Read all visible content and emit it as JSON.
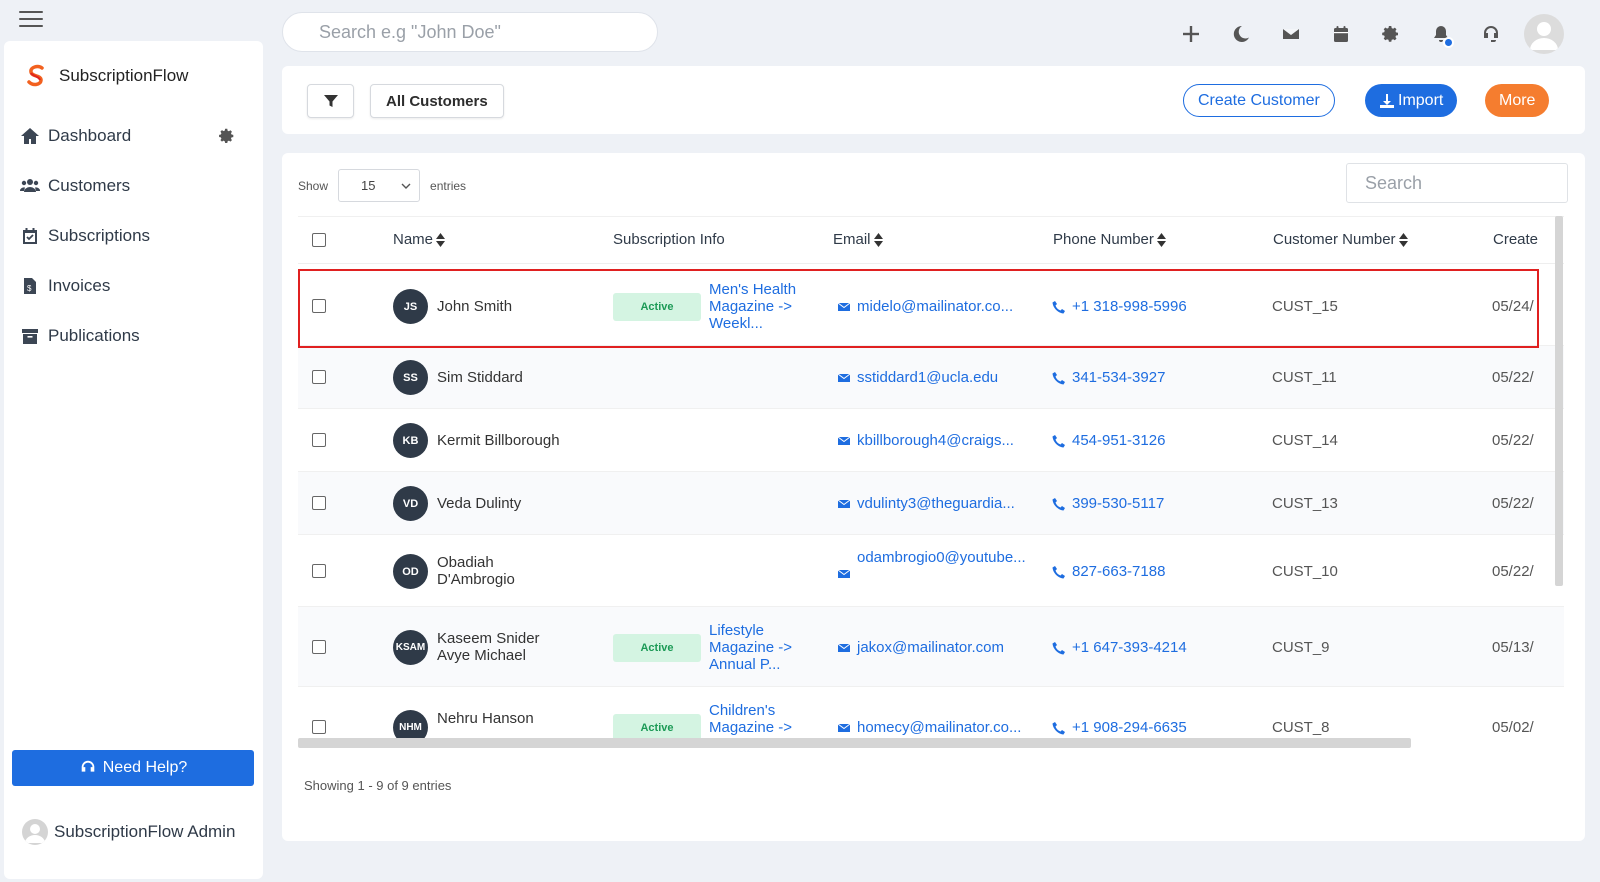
{
  "header": {
    "search_placeholder": "Search e.g \"John Doe\""
  },
  "sidebar": {
    "brand": "SubscriptionFlow",
    "items": [
      {
        "label": "Dashboard"
      },
      {
        "label": "Customers"
      },
      {
        "label": "Subscriptions"
      },
      {
        "label": "Invoices"
      },
      {
        "label": "Publications"
      }
    ],
    "help_label": "Need Help?",
    "admin_name": "SubscriptionFlow Admin"
  },
  "toolbar": {
    "view_label": "All Customers",
    "create_label": "Create Customer",
    "import_label": "Import",
    "more_label": "More"
  },
  "table": {
    "show_label": "Show",
    "entries_value": "15",
    "entries_label": "entries",
    "search_placeholder": "Search",
    "columns": {
      "name": "Name",
      "subscription": "Subscription Info",
      "email": "Email",
      "phone": "Phone Number",
      "customer_number": "Customer Number",
      "created": "Create"
    },
    "rows": [
      {
        "initials": "JS",
        "name": "John Smith",
        "status": "Active",
        "subscription": "Men's Health Magazine -> Weekl...",
        "email": "midelo@mailinator.co...",
        "phone": "+1 318-998-5996",
        "customer_number": "CUST_15",
        "created": "05/24/"
      },
      {
        "initials": "SS",
        "name": "Sim Stiddard",
        "status": "",
        "subscription": "",
        "email": "sstiddard1@ucla.edu",
        "phone": "341-534-3927",
        "customer_number": "CUST_11",
        "created": "05/22/"
      },
      {
        "initials": "KB",
        "name": "Kermit Billborough",
        "status": "",
        "subscription": "",
        "email": "kbillborough4@craigs...",
        "phone": "454-951-3126",
        "customer_number": "CUST_14",
        "created": "05/22/"
      },
      {
        "initials": "VD",
        "name": "Veda Dulinty",
        "status": "",
        "subscription": "",
        "email": "vdulinty3@theguardia...",
        "phone": "399-530-5117",
        "customer_number": "CUST_13",
        "created": "05/22/"
      },
      {
        "initials": "OD",
        "name": "Obadiah D'Ambrogio",
        "status": "",
        "subscription": "",
        "email": "odambrogio0@youtube...",
        "phone": "827-663-7188",
        "customer_number": "CUST_10",
        "created": "05/22/"
      },
      {
        "initials": "KSAM",
        "name": "Kaseem Snider Avye Michael",
        "status": "Active",
        "subscription": "Lifestyle Magazine -> Annual P...",
        "email": "jakox@mailinator.com",
        "phone": "+1 647-393-4214",
        "customer_number": "CUST_9",
        "created": "05/13/"
      },
      {
        "initials": "NHM",
        "name": "Nehru Hanson",
        "status": "Active",
        "subscription": "Children's Magazine ->",
        "email": "homecy@mailinator.co...",
        "phone": "+1 908-294-6635",
        "customer_number": "CUST_8",
        "created": "05/02/"
      }
    ],
    "footer": "Showing 1 - 9 of 9 entries"
  }
}
